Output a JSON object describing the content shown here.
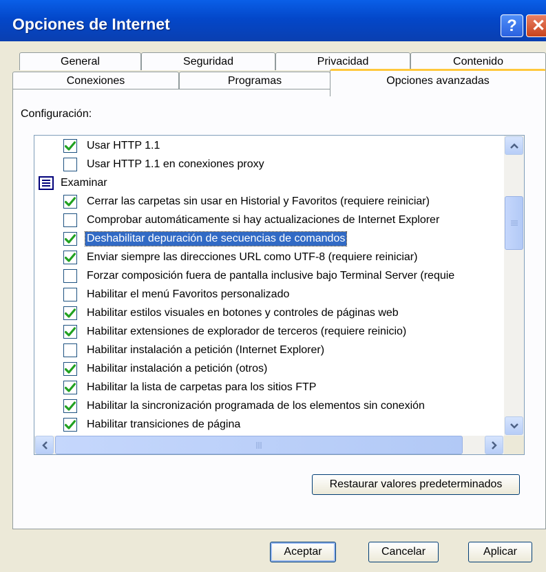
{
  "window": {
    "title": "Opciones de Internet",
    "help_glyph": "?",
    "close_glyph": "✕"
  },
  "tabs": {
    "row1": [
      "General",
      "Seguridad",
      "Privacidad",
      "Contenido"
    ],
    "row2": [
      "Conexiones",
      "Programas",
      "Opciones avanzadas"
    ],
    "active": "Opciones avanzadas"
  },
  "settings": {
    "label": "Configuración:",
    "items": [
      {
        "text": "Usar HTTP 1.1",
        "checked": true
      },
      {
        "text": "Usar HTTP 1.1 en conexiones proxy",
        "checked": false
      },
      {
        "text": "Examinar",
        "group": true
      },
      {
        "text": "Cerrar las carpetas sin usar en Historial y Favoritos (requiere reiniciar)",
        "checked": true
      },
      {
        "text": "Comprobar automáticamente si hay actualizaciones de Internet Explorer",
        "checked": false
      },
      {
        "text": "Deshabilitar depuración de secuencias de comandos",
        "checked": true,
        "selected": true
      },
      {
        "text": "Enviar siempre las direcciones URL como UTF-8 (requiere reiniciar)",
        "checked": true
      },
      {
        "text": "Forzar composición fuera de pantalla inclusive bajo Terminal Server (requie",
        "checked": false
      },
      {
        "text": "Habilitar el menú Favoritos personalizado",
        "checked": false
      },
      {
        "text": "Habilitar estilos visuales en botones y controles de páginas web",
        "checked": true
      },
      {
        "text": "Habilitar extensiones de explorador de terceros (requiere reinicio)",
        "checked": true
      },
      {
        "text": "Habilitar instalación a petición (Internet Explorer)",
        "checked": false
      },
      {
        "text": "Habilitar instalación a petición (otros)",
        "checked": true
      },
      {
        "text": "Habilitar la lista de carpetas para los sitios FTP",
        "checked": true
      },
      {
        "text": "Habilitar la sincronización programada de los elementos sin conexión",
        "checked": true
      },
      {
        "text": "Habilitar transiciones de página",
        "checked": true
      }
    ]
  },
  "buttons": {
    "restore": "Restaurar valores predeterminados",
    "ok": "Aceptar",
    "cancel": "Cancelar",
    "apply": "Aplicar"
  },
  "colors": {
    "accent": "#316ac5",
    "check": "#21a121",
    "titlebar": "#0347c9"
  }
}
